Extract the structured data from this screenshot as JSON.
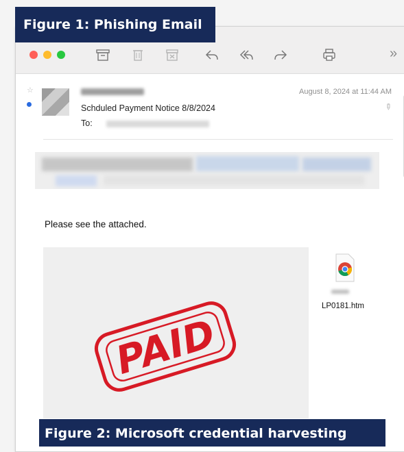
{
  "figure1_caption": "Figure 1: Phishing Email",
  "figure2_caption": "Figure 2: Microsoft credential harvesting",
  "toolbar": {
    "traffic_lights": [
      "#ff5f57",
      "#febc2e",
      "#28c840"
    ],
    "icons": [
      "archive-icon",
      "trash-icon",
      "junk-icon",
      "reply-icon",
      "reply-all-icon",
      "forward-icon",
      "print-icon"
    ],
    "overflow": "»"
  },
  "message": {
    "subject": "Schduled Payment Notice 8/8/2024",
    "to_label": "To:",
    "date": "August 8, 2024 at 11:44 AM",
    "body": "Please see the attached.",
    "stamp": "PAID"
  },
  "attachment": {
    "filename": "LP0181.htm",
    "icon": "chrome-icon"
  },
  "colors": {
    "caption_bg": "#172a59",
    "stamp_red": "#d71a25",
    "unread_blue": "#2a6be0"
  }
}
